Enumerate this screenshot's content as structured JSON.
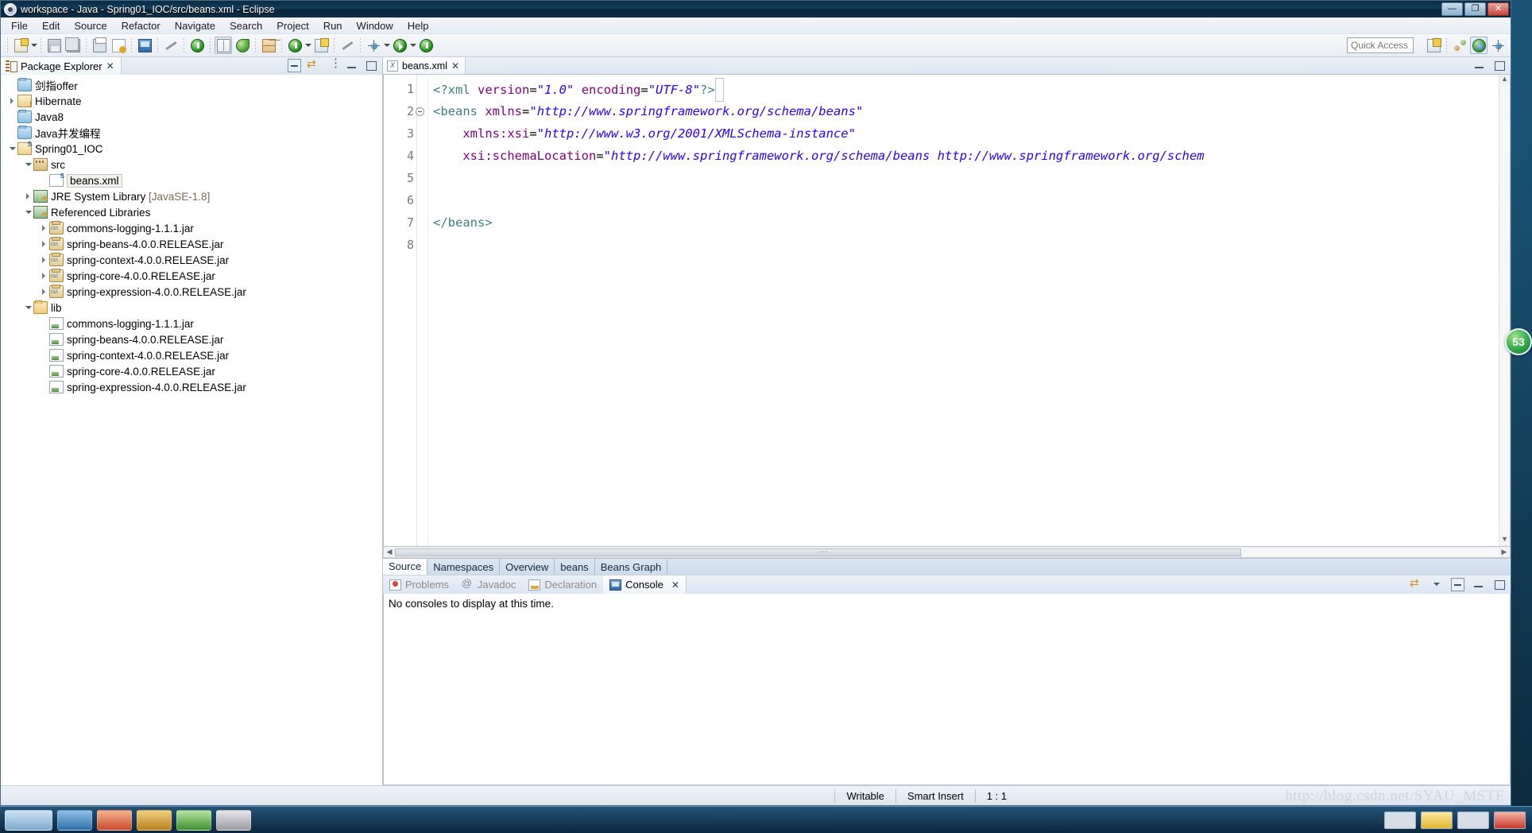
{
  "window": {
    "title": "workspace - Java - Spring01_IOC/src/beans.xml - Eclipse",
    "minimize_label": "—",
    "maximize_label": "❐",
    "close_label": "✕"
  },
  "menubar": {
    "items": [
      "File",
      "Edit",
      "Source",
      "Refactor",
      "Navigate",
      "Search",
      "Project",
      "Run",
      "Window",
      "Help"
    ]
  },
  "toolbar": {
    "quick_access_placeholder": "Quick Access",
    "quick_access_value": "",
    "icons": [
      "new-wizard-icon",
      "new-dropdown-caret",
      "save-icon",
      "save-all-icon",
      "print-icon",
      "xml-validate-icon",
      "open-console-icon",
      "toggle-markers-icon",
      "refresh-green-icon",
      "open-type-icon",
      "spring-leaf-icon",
      "new-grid-icon",
      "new-class-icon",
      "new-class-caret",
      "new-annotation-icon",
      "search-declaration-icon",
      "debug-icon",
      "debug-caret",
      "run-icon",
      "run-caret",
      "run-server-icon"
    ],
    "right_icons": [
      "new-window-icon",
      "open-perspective-icon",
      "java-perspective-icon",
      "debug-perspective-icon"
    ]
  },
  "explorer": {
    "tab_label": "Package Explorer",
    "tab_icon": "package-explorer-icon",
    "close_label": "✕",
    "tools": [
      "collapse-all-icon",
      "link-with-editor-icon",
      "view-menu-icon",
      "minimize-icon",
      "maximize-icon"
    ],
    "items": [
      {
        "label": "剑指offer",
        "indent": 1,
        "arrow": "none",
        "icon": "folder-icon",
        "selected": false
      },
      {
        "label": "Hibernate",
        "indent": 1,
        "arrow": "closed",
        "icon": "project-warning-icon",
        "selected": false
      },
      {
        "label": "Java8",
        "indent": 1,
        "arrow": "none",
        "icon": "folder-icon",
        "selected": false
      },
      {
        "label": "Java并发编程",
        "indent": 1,
        "arrow": "none",
        "icon": "folder-icon",
        "selected": false
      },
      {
        "label": "Spring01_IOC",
        "indent": 1,
        "arrow": "open",
        "icon": "spring-project-icon",
        "selected": false
      },
      {
        "label": "src",
        "indent": 2,
        "arrow": "open",
        "icon": "source-folder-icon",
        "selected": false
      },
      {
        "label": "beans.xml",
        "indent": 3,
        "arrow": "none",
        "icon": "spring-xml-file-icon",
        "selected": true
      },
      {
        "label": "JRE System Library",
        "indent": 2,
        "arrow": "closed",
        "icon": "library-icon",
        "selected": false,
        "suffix": "[JavaSE-1.8]"
      },
      {
        "label": "Referenced Libraries",
        "indent": 2,
        "arrow": "open",
        "icon": "library-icon",
        "selected": false
      },
      {
        "label": "commons-logging-1.1.1.jar",
        "indent": 3,
        "arrow": "closed",
        "icon": "jar-icon",
        "selected": false
      },
      {
        "label": "spring-beans-4.0.0.RELEASE.jar",
        "indent": 3,
        "arrow": "closed",
        "icon": "jar-icon",
        "selected": false
      },
      {
        "label": "spring-context-4.0.0.RELEASE.jar",
        "indent": 3,
        "arrow": "closed",
        "icon": "jar-icon",
        "selected": false
      },
      {
        "label": "spring-core-4.0.0.RELEASE.jar",
        "indent": 3,
        "arrow": "closed",
        "icon": "jar-icon",
        "selected": false
      },
      {
        "label": "spring-expression-4.0.0.RELEASE.jar",
        "indent": 3,
        "arrow": "closed",
        "icon": "jar-icon",
        "selected": false
      },
      {
        "label": "lib",
        "indent": 2,
        "arrow": "open",
        "icon": "folder-open-icon",
        "selected": false
      },
      {
        "label": "commons-logging-1.1.1.jar",
        "indent": 3,
        "arrow": "none",
        "icon": "jar-file-icon",
        "selected": false
      },
      {
        "label": "spring-beans-4.0.0.RELEASE.jar",
        "indent": 3,
        "arrow": "none",
        "icon": "jar-file-icon",
        "selected": false
      },
      {
        "label": "spring-context-4.0.0.RELEASE.jar",
        "indent": 3,
        "arrow": "none",
        "icon": "jar-file-icon",
        "selected": false
      },
      {
        "label": "spring-core-4.0.0.RELEASE.jar",
        "indent": 3,
        "arrow": "none",
        "icon": "jar-file-icon",
        "selected": false
      },
      {
        "label": "spring-expression-4.0.0.RELEASE.jar",
        "indent": 3,
        "arrow": "none",
        "icon": "jar-file-icon",
        "selected": false
      }
    ]
  },
  "editor": {
    "tab_label": "beans.xml",
    "tab_icon": "xml-file-icon",
    "close_label": "✕",
    "tools": [
      "minimize-icon",
      "maximize-icon"
    ],
    "line_numbers": [
      "1",
      "2",
      "3",
      "4",
      "5",
      "6",
      "7",
      "8"
    ],
    "lines": [
      {
        "n": "1",
        "fold": false,
        "highlight": true,
        "text": "<?xml version=\"1.0\" encoding=\"UTF-8\"?>"
      },
      {
        "n": "2",
        "fold": true,
        "highlight": false,
        "text": "<beans xmlns=\"http://www.springframework.org/schema/beans\""
      },
      {
        "n": "3",
        "fold": false,
        "highlight": false,
        "text": "    xmlns:xsi=\"http://www.w3.org/2001/XMLSchema-instance\""
      },
      {
        "n": "4",
        "fold": false,
        "highlight": false,
        "text": "    xsi:schemaLocation=\"http://www.springframework.org/schema/beans http://www.springframework.org/schem"
      },
      {
        "n": "5",
        "fold": false,
        "highlight": false,
        "text": ""
      },
      {
        "n": "6",
        "fold": false,
        "highlight": false,
        "text": ""
      },
      {
        "n": "7",
        "fold": false,
        "highlight": false,
        "text": "</beans>"
      },
      {
        "n": "8",
        "fold": false,
        "highlight": false,
        "text": ""
      }
    ],
    "page_tabs": [
      {
        "label": "Source",
        "active": true
      },
      {
        "label": "Namespaces",
        "active": false
      },
      {
        "label": "Overview",
        "active": false
      },
      {
        "label": "beans",
        "active": false
      },
      {
        "label": "Beans Graph",
        "active": false
      }
    ],
    "hscroll_left_arrow": "◀",
    "hscroll_right_arrow": "▶",
    "vscroll_up_arrow": "▲",
    "vscroll_down_arrow": "▼"
  },
  "console": {
    "tabs": [
      {
        "label": "Problems",
        "icon": "problems-icon",
        "active": false
      },
      {
        "label": "Javadoc",
        "icon": "javadoc-icon",
        "active": false
      },
      {
        "label": "Declaration",
        "icon": "declaration-icon",
        "active": false
      },
      {
        "label": "Console",
        "icon": "console-icon",
        "active": true
      }
    ],
    "close_label": "✕",
    "tools": [
      "open-console-icon",
      "display-selected-console-icon",
      "pin-console-icon",
      "minimize-icon",
      "maximize-icon"
    ],
    "message": "No consoles to display at this time."
  },
  "statusbar": {
    "writable": "Writable",
    "insert_mode": "Smart Insert",
    "cursor_position": "1 : 1",
    "watermark": "http://blog.csdn.net/SYAU_MSTF"
  },
  "overlay": {
    "badge_value": "53"
  },
  "colors": {
    "tag": "#3f7f7f",
    "attribute": "#7f007f",
    "value": "#2a00ff",
    "selection": "#e8f1fb",
    "titlebar": "#0d2e47",
    "accent": "#2f6aa8"
  }
}
